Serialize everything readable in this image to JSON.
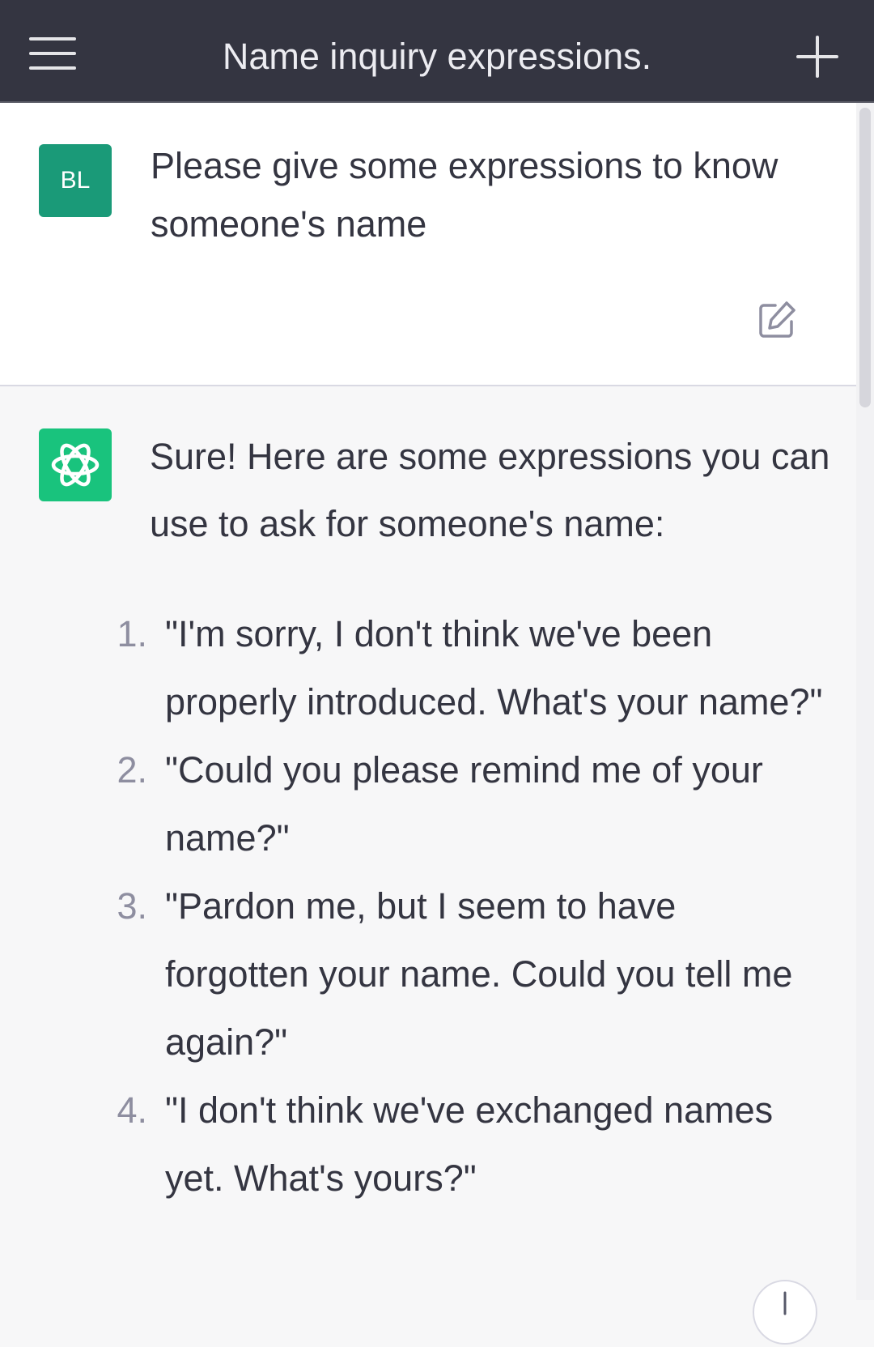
{
  "header": {
    "title": "Name inquiry expressions.",
    "menu_icon": "hamburger-menu-icon",
    "new_chat_icon": "plus-icon"
  },
  "user_message": {
    "avatar_initials": "BL",
    "text": "Please give some expressions to know someone's name",
    "edit_icon": "edit-icon"
  },
  "assistant_message": {
    "avatar_icon": "openai-logo-icon",
    "intro": "Sure! Here are some expressions you can use to ask for someone's name:",
    "items": [
      {
        "num": "1.",
        "text": "\"I'm sorry, I don't think we've been properly introduced. What's your name?\""
      },
      {
        "num": "2.",
        "text": "\"Could you please remind me of your name?\""
      },
      {
        "num": "3.",
        "text": "\"Pardon me, but I seem to have forgotten your name. Could you tell me again?\""
      },
      {
        "num": "4.",
        "text": "\"I don't think we've exchanged names yet. What's yours?\""
      }
    ]
  },
  "colors": {
    "header_bg": "#343541",
    "user_avatar_bg": "#1a9a78",
    "bot_avatar_bg": "#19c37d",
    "assistant_bg": "#f7f7f8"
  }
}
